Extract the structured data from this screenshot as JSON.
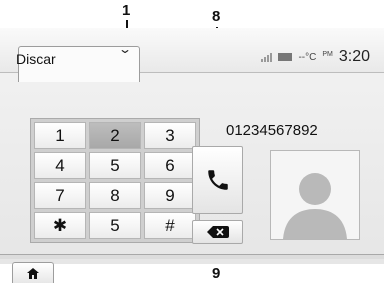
{
  "callouts": {
    "one": "1",
    "eight": "8",
    "nine": "9"
  },
  "header": {
    "tab_label": "Discar",
    "temperature": "--°C",
    "period": "PM",
    "time": "3:20"
  },
  "keypad": {
    "keys": [
      "1",
      "2",
      "3",
      "4",
      "5",
      "6",
      "7",
      "8",
      "9",
      "✱",
      "5",
      "#"
    ],
    "active_key": "2"
  },
  "display": {
    "dialed_number": "01234567892"
  },
  "icons": {
    "call": "phone-icon",
    "delete": "backspace-icon",
    "home": "home-icon",
    "contact": "contact-avatar-icon",
    "dropdown": "chevron-down-icon"
  }
}
